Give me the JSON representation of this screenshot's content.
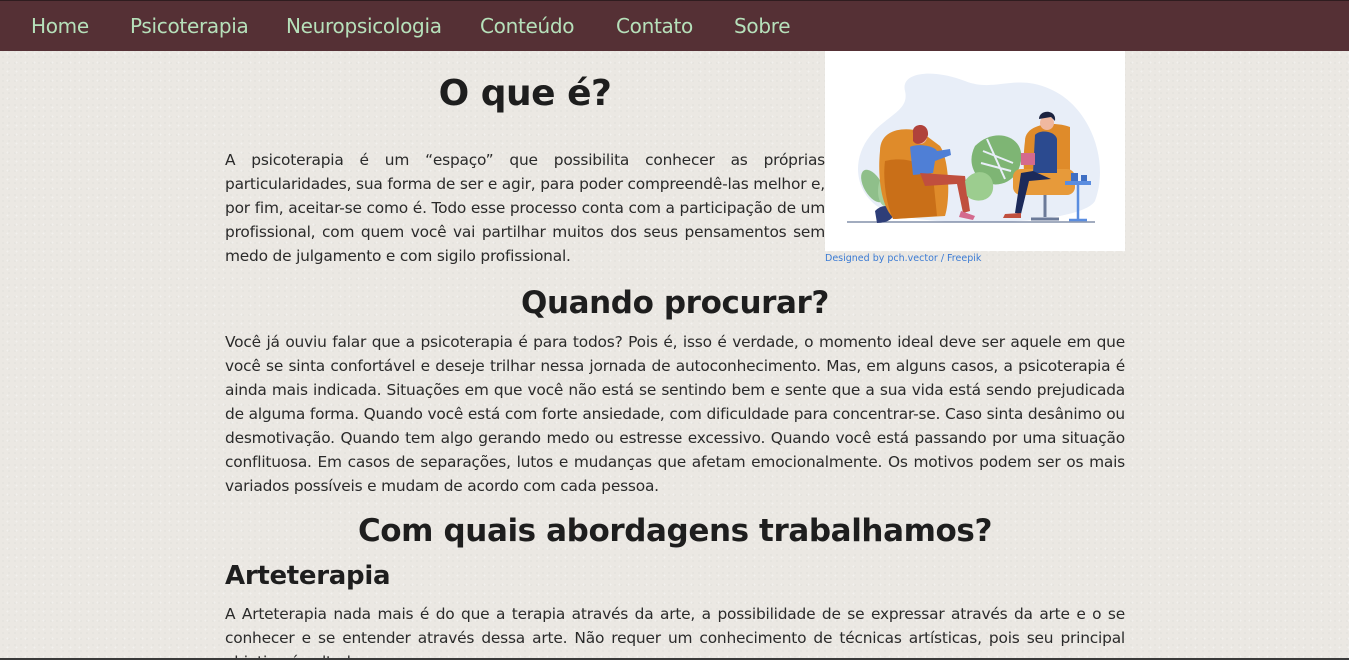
{
  "nav": {
    "items": [
      {
        "label": "Home"
      },
      {
        "label": "Psicoterapia"
      },
      {
        "label": "Neuropsicologia"
      },
      {
        "label": "Conteúdo"
      },
      {
        "label": "Contato"
      },
      {
        "label": "Sobre"
      }
    ]
  },
  "colors": {
    "navbar_bg": "#553035",
    "nav_link": "#b6e0ba",
    "page_bg": "#ebe8e3",
    "credit_link": "#3b7bd4"
  },
  "section_what": {
    "title": "O que é?",
    "text": "A psicoterapia é um “espaço” que possibilita conhecer as próprias particularidades, sua forma de ser e agir, para poder compreendê-las melhor e, por fim, aceitar-se como é. Todo esse processo conta com a participação de um profissional, com quem você vai partilhar muitos dos seus pensamentos sem medo de julgamento e com sigilo profissional.",
    "image_credit": "Designed by pch.vector / Freepik",
    "image_icon": "therapy-session-illustration"
  },
  "section_when": {
    "title": "Quando procurar?",
    "text": "Você já ouviu falar que a psicoterapia é para todos? Pois é, isso é verdade, o momento ideal deve ser aquele em que você se sinta confortável e deseje trilhar nessa jornada de autoconhecimento. Mas, em alguns casos, a psicoterapia é ainda mais indicada. Situações em que você não está se sentindo bem e sente que a sua vida está sendo prejudicada de alguma forma. Quando você está com forte ansiedade, com dificuldade para concentrar-se. Caso sinta desânimo ou desmotivação. Quando tem algo gerando medo ou estresse excessivo. Quando você está passando por uma situação conflituosa. Em casos de separações, lutos e mudanças que afetam emocionalmente. Os motivos podem ser os mais variados possíveis e mudam de acordo com cada pessoa."
  },
  "section_approaches": {
    "title": "Com quais abordagens trabalhamos?",
    "arteterapia": {
      "title": "Arteterapia",
      "text": "A Arteterapia nada mais é do que a terapia através da arte, a possibilidade de se expressar através da arte e o se conhecer e se entender através dessa arte. Não requer um conhecimento de técnicas artísticas, pois seu principal objetivo é voltado para a"
    }
  }
}
